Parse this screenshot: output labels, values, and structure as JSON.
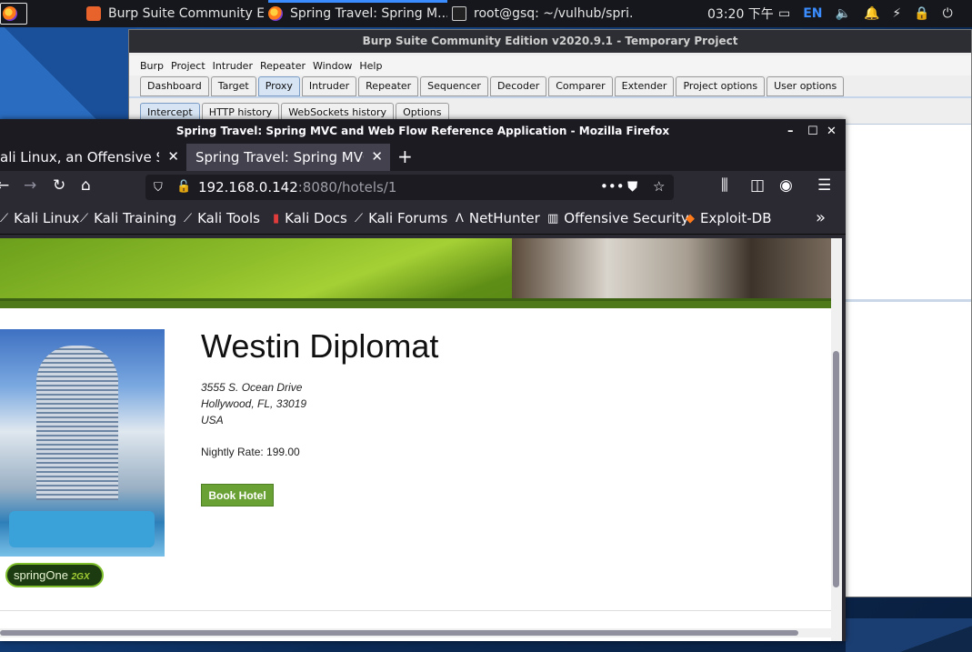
{
  "topbar": {
    "tasks": [
      {
        "label": "Burp Suite Community E...",
        "icon": "burp-icon"
      },
      {
        "label": "Spring Travel: Spring M...",
        "icon": "firefox-icon"
      },
      {
        "label": "root@gsq: ~/vulhub/spri...",
        "icon": "terminal-icon"
      }
    ],
    "clock": "03:20 下午",
    "lang": "EN"
  },
  "burp": {
    "title": "Burp Suite Community Edition v2020.9.1 - Temporary Project",
    "menu": [
      "Burp",
      "Project",
      "Intruder",
      "Repeater",
      "Window",
      "Help"
    ],
    "tabs": [
      "Dashboard",
      "Target",
      "Proxy",
      "Intruder",
      "Repeater",
      "Sequencer",
      "Decoder",
      "Comparer",
      "Extender",
      "Project options",
      "User options"
    ],
    "subtabs": [
      "Intercept",
      "HTTP history",
      "WebSockets history",
      "Options"
    ]
  },
  "firefox": {
    "title": "Spring Travel: Spring MVC and Web Flow Reference Application - Mozilla Firefox",
    "tabs": [
      {
        "label": "ali Linux, an Offensive Secu"
      },
      {
        "label": "Spring Travel: Spring MVC ar"
      }
    ],
    "url_host": "192.168.0.142",
    "url_rest": ":8080/hotels/1",
    "bookmarks": [
      "Kali Linux",
      "Kali Training",
      "Kali Tools",
      "Kali Docs",
      "Kali Forums",
      "NetHunter",
      "Offensive Security",
      "Exploit-DB"
    ]
  },
  "page": {
    "hotel_name": "Westin Diplomat",
    "address_line1": "3555 S. Ocean Drive",
    "address_line2": "Hollywood, FL, 33019",
    "country": "USA",
    "rate_label": "Nightly Rate: 199.00",
    "book_button": "Book Hotel",
    "logo_text": "springOne",
    "logo_year": "2GX"
  },
  "colors": {
    "accent": "#3b8cff",
    "book_button": "#6aa135"
  }
}
